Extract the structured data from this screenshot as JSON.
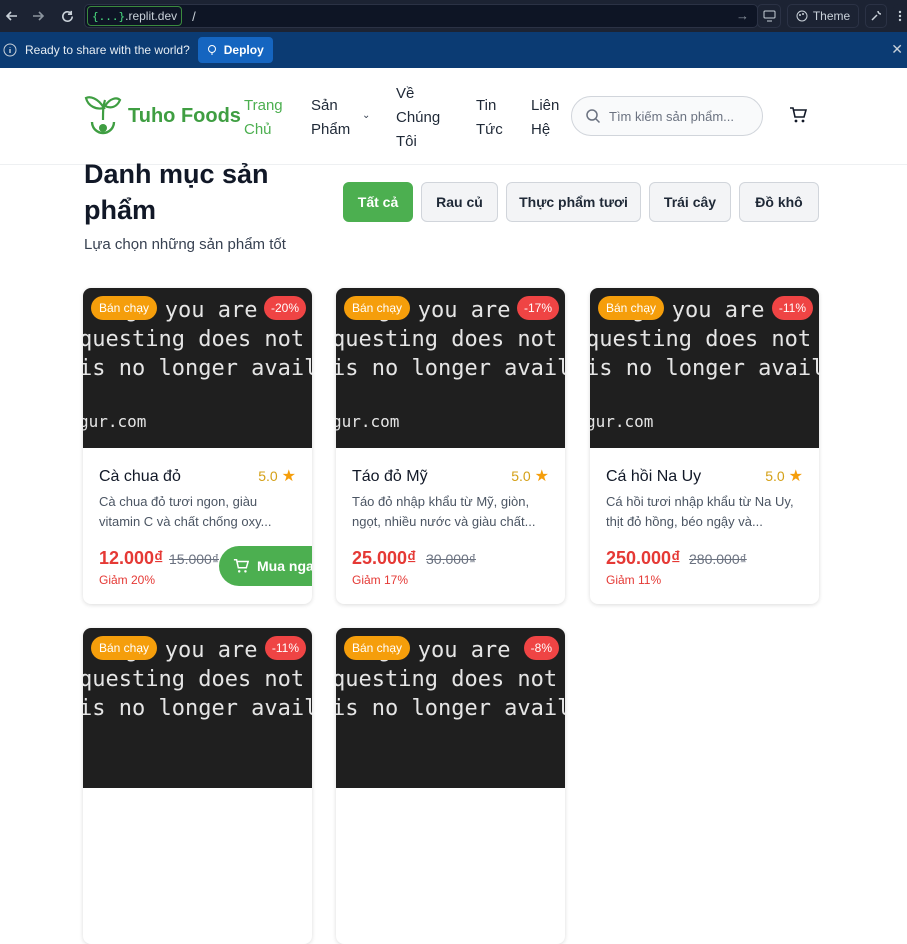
{
  "browser": {
    "url_host_brace": "{...}",
    "url_host": ".replit.dev",
    "url_path": "/",
    "theme_label": "Theme"
  },
  "sharebar": {
    "message": "Ready to share with the world?",
    "deploy_label": "Deploy"
  },
  "header": {
    "logo_text": "Tuho Foods",
    "nav": [
      {
        "label_line1": "Trang",
        "label_line2": "Chủ",
        "label_line3": ""
      },
      {
        "label_line1": "Sản",
        "label_line2": "Phẩm",
        "label_line3": ""
      },
      {
        "label_line1": "Về",
        "label_line2": "Chúng",
        "label_line3": "Tôi"
      },
      {
        "label_line1": "Tin",
        "label_line2": "Tức",
        "label_line3": ""
      },
      {
        "label_line1": "Liên",
        "label_line2": "Hệ",
        "label_line3": ""
      }
    ],
    "search_placeholder": "Tìm kiếm sản phẩm..."
  },
  "category": {
    "title_line1": "Danh mục sản",
    "title_line2": "phẩm",
    "subtitle": "Lựa chọn những sản phẩm tốt",
    "filters": [
      "Tất cả",
      "Rau củ",
      "Thực phẩm tươi",
      "Trái cây",
      "Đồ khô"
    ],
    "active_filter": "Tất cả"
  },
  "image_placeholder_text": {
    "line1": "ge you are",
    "line2": "questing does not ex",
    "line3": "is no longer availabl",
    "footer": "gur.com"
  },
  "products": [
    {
      "hot_label": "Bán chạy",
      "discount": "-20%",
      "name": "Cà chua đỏ",
      "rating": "5.0",
      "desc": "Cà chua đỏ tươi ngon, giàu vitamin C và chất chống oxy...",
      "price": "12.000₫",
      "old_price": "15.000₫",
      "save": "Giảm 20%",
      "buy_label": "Mua ngay"
    },
    {
      "hot_label": "Bán chạy",
      "discount": "-17%",
      "name": "Táo đỏ Mỹ",
      "rating": "5.0",
      "desc": "Táo đỏ nhập khẩu từ Mỹ, giòn, ngọt, nhiều nước và giàu chất...",
      "price": "25.000₫",
      "old_price": "30.000₫",
      "save": "Giảm 17%"
    },
    {
      "hot_label": "Bán chạy",
      "discount": "-11%",
      "name": "Cá hồi Na Uy",
      "rating": "5.0",
      "desc": "Cá hồi tươi nhập khẩu từ Na Uy, thịt đỏ hồng, béo ngậy và...",
      "price": "250.000₫",
      "old_price": "280.000₫",
      "save": "Giảm 11%"
    },
    {
      "hot_label": "Bán chạy",
      "discount": "-11%"
    },
    {
      "hot_label": "Bán chạy",
      "discount": "-8%"
    }
  ],
  "colors": {
    "brand_green": "#4caf50",
    "sale_red": "#e53935",
    "hot_orange": "#f59e0b",
    "discount_red": "#ef4444"
  }
}
